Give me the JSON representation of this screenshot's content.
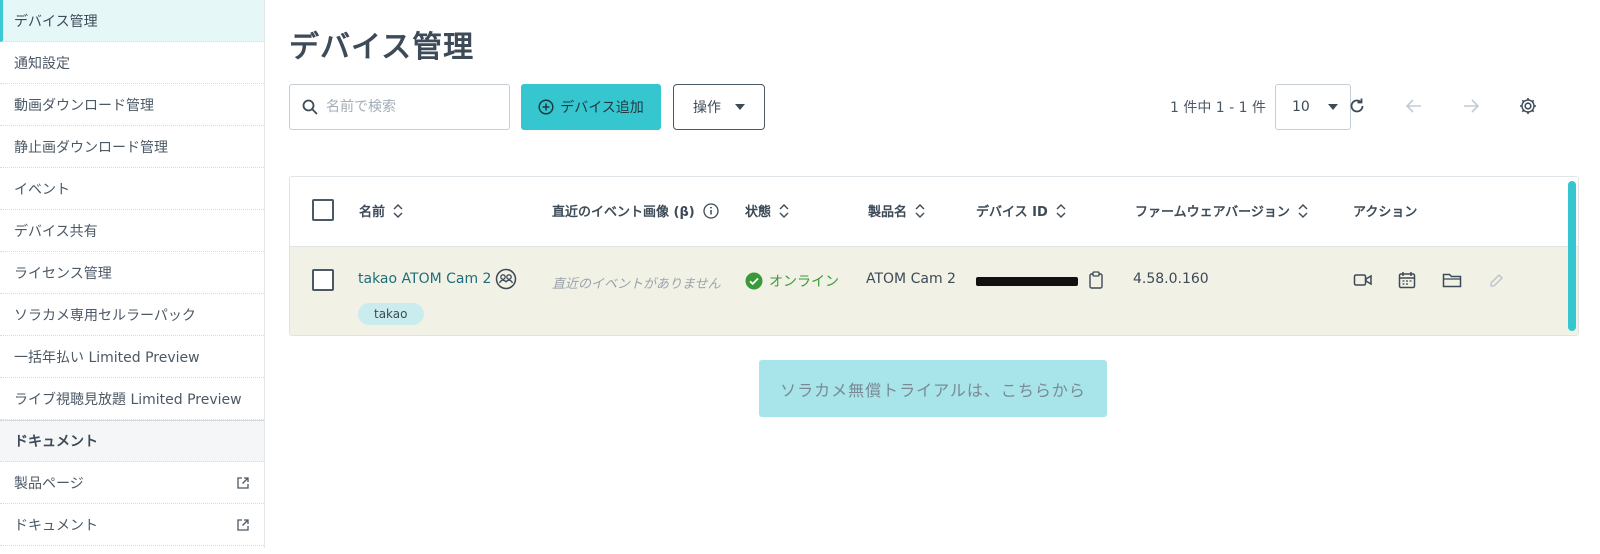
{
  "sidebar": {
    "items": [
      {
        "label": "デバイス管理"
      },
      {
        "label": "通知設定"
      },
      {
        "label": "動画ダウンロード管理"
      },
      {
        "label": "静止画ダウンロード管理"
      },
      {
        "label": "イベント"
      },
      {
        "label": "デバイス共有"
      },
      {
        "label": "ライセンス管理"
      },
      {
        "label": "ソラカメ専用セルラーパック"
      },
      {
        "label": "一括年払い Limited Preview"
      },
      {
        "label": "ライブ視聴見放題 Limited Preview"
      }
    ],
    "section_label": "ドキュメント",
    "doc_items": [
      {
        "label": "製品ページ"
      },
      {
        "label": "ドキュメント"
      }
    ]
  },
  "main": {
    "title": "デバイス管理",
    "search_placeholder": "名前で検索",
    "add_button": "デバイス追加",
    "ops_button": "操作",
    "range_text": "1 件中 1 - 1 件",
    "per_page": "10"
  },
  "table": {
    "columns": [
      "名前",
      "直近のイベント画像 (β)",
      "状態",
      "製品名",
      "デバイス ID",
      "ファームウェアバージョン",
      "アクション"
    ],
    "rows": [
      {
        "name": "takao ATOM Cam 2",
        "tag": "takao",
        "recent_event": "直近のイベントがありません",
        "status": "オンライン",
        "product": "ATOM Cam 2",
        "firmware": "4.58.0.160"
      }
    ]
  },
  "trial_button": "ソラカメ無償トライアルは、こちらから",
  "colors": {
    "accent": "#36c6d0",
    "status_online": "#3a9a3a",
    "row_bg": "#f2f1e6",
    "link": "#1f6f7a"
  }
}
